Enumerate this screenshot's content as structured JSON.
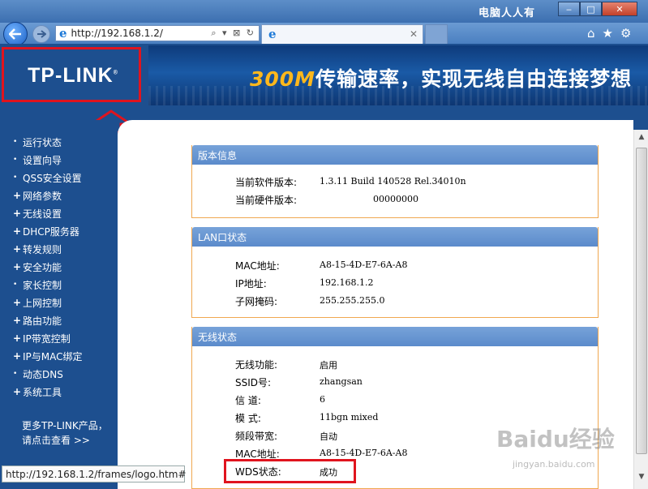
{
  "window": {
    "title_watermark": "电脑人人有",
    "controls": [
      "‒",
      "□",
      "✕"
    ]
  },
  "browser": {
    "back_icon": "back-arrow-icon",
    "forward_icon": "forward-arrow-icon",
    "address": "http://192.168.1.2/",
    "address_icons": "⌕ ▾ ⊠ ↻",
    "tab_icon": "ie-icon",
    "tab_close": "✕",
    "tool_icons": [
      "⌂",
      "★",
      "⚙"
    ]
  },
  "brand": {
    "logo": "TP-LINK",
    "banner_highlight": "300M",
    "banner_text": "传输速率，实现无线自由连接梦想"
  },
  "sidebar": {
    "items": [
      {
        "marker": "•",
        "label": "运行状态"
      },
      {
        "marker": "•",
        "label": "设置向导"
      },
      {
        "marker": "•",
        "label": "QSS安全设置"
      },
      {
        "marker": "+",
        "label": "网络参数"
      },
      {
        "marker": "+",
        "label": "无线设置"
      },
      {
        "marker": "+",
        "label": "DHCP服务器"
      },
      {
        "marker": "+",
        "label": "转发规则"
      },
      {
        "marker": "+",
        "label": "安全功能"
      },
      {
        "marker": "•",
        "label": "家长控制"
      },
      {
        "marker": "+",
        "label": "上网控制"
      },
      {
        "marker": "+",
        "label": "路由功能"
      },
      {
        "marker": "+",
        "label": "IP带宽控制"
      },
      {
        "marker": "+",
        "label": "IP与MAC绑定"
      },
      {
        "marker": "•",
        "label": "动态DNS"
      },
      {
        "marker": "+",
        "label": "系统工具"
      }
    ],
    "more_line1": "更多TP-LINK产品，",
    "more_line2": "请点击查看 >>"
  },
  "panels": {
    "version": {
      "title": "版本信息",
      "rows": [
        {
          "label": "当前软件版本:",
          "value": "1.3.11 Build 140528 Rel.34010n"
        },
        {
          "label": "当前硬件版本:",
          "value": "00000000"
        }
      ]
    },
    "lan": {
      "title": "LAN口状态",
      "rows": [
        {
          "label": "MAC地址:",
          "value": "A8-15-4D-E7-6A-A8"
        },
        {
          "label": "IP地址:",
          "value": "192.168.1.2"
        },
        {
          "label": "子网掩码:",
          "value": "255.255.255.0"
        }
      ]
    },
    "wireless": {
      "title": "无线状态",
      "rows": [
        {
          "label": "无线功能:",
          "value": "启用"
        },
        {
          "label": "SSID号:",
          "value": "zhangsan"
        },
        {
          "label": "信 道:",
          "value": "6"
        },
        {
          "label": "模 式:",
          "value": "11bgn mixed"
        },
        {
          "label": "频段带宽:",
          "value": "自动"
        },
        {
          "label": "MAC地址:",
          "value": "A8-15-4D-E7-6A-A8"
        },
        {
          "label": "WDS状态:",
          "value": "成功"
        }
      ]
    }
  },
  "statusbar": {
    "text": "http://192.168.1.2/frames/logo.htm#"
  },
  "watermark": {
    "brand": "Baidu经验",
    "url": "jingyan.baidu.com"
  },
  "colors": {
    "router_blue": "#1d4f8f",
    "panel_header": "#5b8bcb",
    "panel_border": "#f0a850",
    "highlight_red": "#e0141e",
    "banner_accent": "#ffb81c"
  }
}
